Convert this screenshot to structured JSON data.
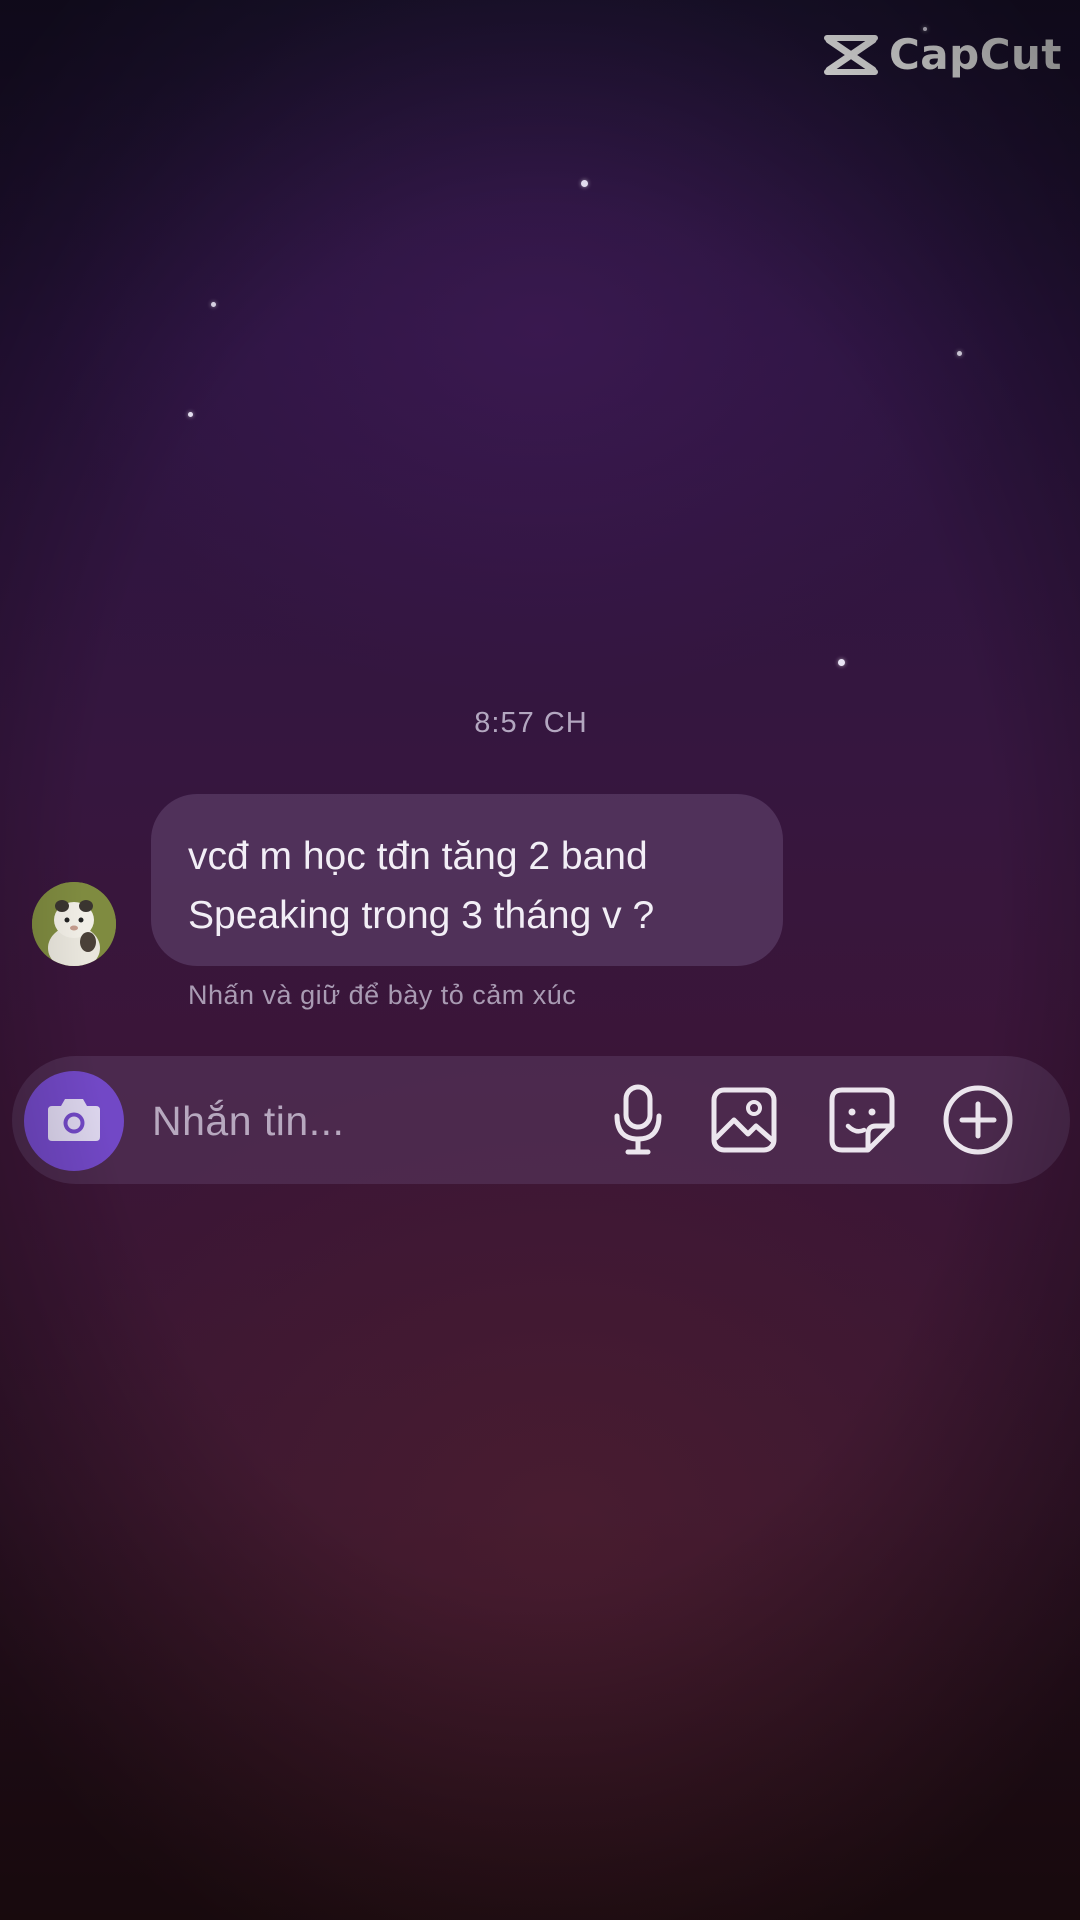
{
  "watermark": {
    "text": "CapCut",
    "icon": "capcut-logo-icon"
  },
  "chat": {
    "timestamp": "8:57 CH",
    "message": {
      "sender_avatar": "avatar-icon",
      "lines": [
        "vcđ m học tđn tăng 2 band",
        "Speaking trong 3 tháng v ?"
      ]
    },
    "reaction_hint": "Nhấn và giữ để bày tỏ cảm xúc"
  },
  "composer": {
    "placeholder": "Nhắn tin...",
    "buttons": [
      {
        "icon": "camera-icon"
      },
      {
        "icon": "microphone-icon"
      },
      {
        "icon": "image-icon"
      },
      {
        "icon": "sticker-icon"
      },
      {
        "icon": "plus-circle-icon"
      }
    ]
  },
  "colors": {
    "camera_button": "#7248c6",
    "bubble": "#60426c",
    "background_top": "#1c1330",
    "background_bottom": "#2b1218"
  }
}
